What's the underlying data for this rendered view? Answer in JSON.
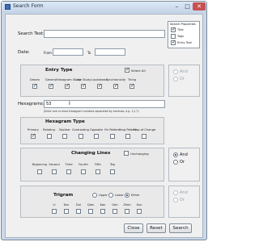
{
  "window": {
    "title": "Search Form",
    "minimize_glyph": "–",
    "maximize_glyph": "□",
    "close_glyph": "✕"
  },
  "search_text": {
    "label": "Search Text:",
    "value": ""
  },
  "search_in": {
    "title": "Search Properties",
    "options": [
      {
        "label": "Title",
        "checked": true
      },
      {
        "label": "Tags",
        "checked": false
      },
      {
        "label": "Entry Text",
        "checked": true
      }
    ]
  },
  "date": {
    "label": "Date:",
    "from_label": "From",
    "to_label": "To",
    "from_value": "",
    "to_value": ""
  },
  "entry_type": {
    "title": "Entry Type",
    "select_all_label": "Select All",
    "select_all_checked": true,
    "items": [
      {
        "label": "Dream",
        "checked": true
      },
      {
        "label": "General",
        "checked": true
      },
      {
        "label": "Hexagram Study",
        "checked": true
      },
      {
        "label": "Line Study",
        "checked": true
      },
      {
        "label": "Lookahead",
        "checked": true
      },
      {
        "label": "Synchronicity",
        "checked": true
      },
      {
        "label": "Thing",
        "checked": true
      }
    ],
    "and_label": "And",
    "or_label": "Or"
  },
  "hexagrams": {
    "label": "Hexagrams:",
    "value": "53",
    "hint": "(Enter one or more hexagram numbers separated by commas; e.g. 1,2,7)"
  },
  "hexagram_type": {
    "title": "Hexagram Type",
    "items": [
      {
        "label": "Primary",
        "checked": true
      },
      {
        "label": "Relating",
        "checked": false
      },
      {
        "label": "Nuclear",
        "checked": false
      },
      {
        "label": "Contrasting",
        "checked": false
      },
      {
        "label": "Opposite",
        "checked": false
      },
      {
        "label": "Yin Pattern",
        "checked": false
      },
      {
        "label": "Yang Pattern",
        "checked": false
      },
      {
        "label": "Step of Change",
        "checked": false
      }
    ]
  },
  "changing_lines": {
    "title": "Changing Lines",
    "unchanging_label": "Unchanging",
    "items": [
      {
        "label": "Beginning",
        "checked": false
      },
      {
        "label": "Second",
        "checked": false
      },
      {
        "label": "Third",
        "checked": false
      },
      {
        "label": "Fourth",
        "checked": false
      },
      {
        "label": "Fifth",
        "checked": false
      },
      {
        "label": "Top",
        "checked": false
      }
    ],
    "and_label": "And",
    "or_label": "Or",
    "selected": "And"
  },
  "trigram": {
    "title": "Trigram",
    "options": [
      {
        "label": "Upper",
        "selected": false
      },
      {
        "label": "Lower",
        "selected": false
      },
      {
        "label": "Either",
        "selected": true
      }
    ],
    "items": [
      {
        "label": "Li",
        "checked": false
      },
      {
        "label": "Kun",
        "checked": false
      },
      {
        "label": "Dui",
        "checked": false
      },
      {
        "label": "Qian",
        "checked": false
      },
      {
        "label": "Kan",
        "checked": false
      },
      {
        "label": "Gen",
        "checked": false
      },
      {
        "label": "Zhen",
        "checked": false
      },
      {
        "label": "Xun",
        "checked": false
      }
    ]
  },
  "buttons": {
    "close": "Close",
    "reset": "Reset",
    "search": "Search"
  },
  "check_glyph": "✓",
  "colors": {
    "window_frame": "#c9d7e8",
    "client": "#f0f0f0",
    "group": "#e9e9e9",
    "close_button": "#c75050"
  }
}
